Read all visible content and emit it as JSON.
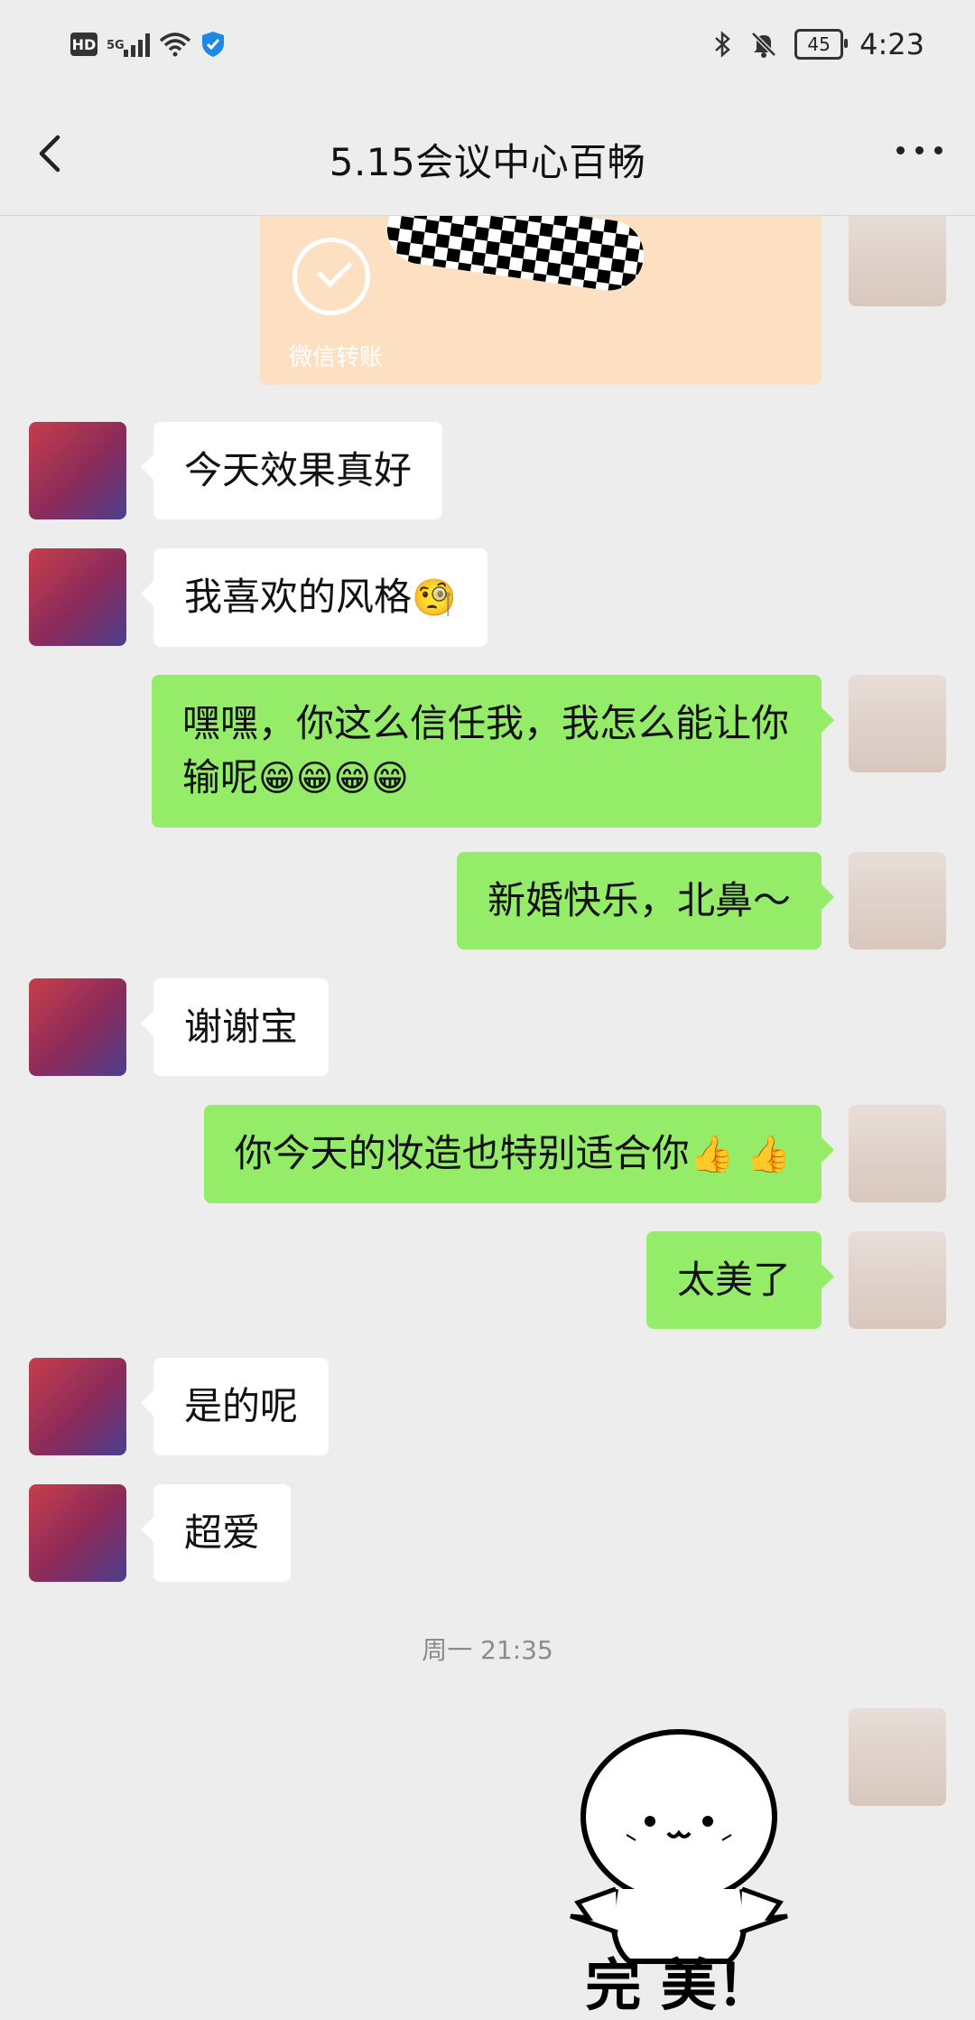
{
  "status_bar": {
    "hd": "HD",
    "network": "5G",
    "time": "4:23",
    "battery": "45"
  },
  "nav": {
    "title": "5.15会议中心百畅"
  },
  "transfer": {
    "label": "微信转账"
  },
  "messages": [
    {
      "from": "other",
      "text": "今天效果真好"
    },
    {
      "from": "other",
      "text": "我喜欢的风格",
      "emoji": "🧐"
    },
    {
      "from": "me",
      "text": "嘿嘿，你这么信任我，我怎么能让你输呢",
      "emoji": "😁😁😁😁"
    },
    {
      "from": "me",
      "text": "新婚快乐，北鼻～"
    },
    {
      "from": "other",
      "text": "谢谢宝"
    },
    {
      "from": "me",
      "text": "你今天的妆造也特别适合你",
      "emoji": "👍 👍"
    },
    {
      "from": "me",
      "text": "太美了"
    },
    {
      "from": "other",
      "text": "是的呢"
    },
    {
      "from": "other",
      "text": "超爱"
    }
  ],
  "timestamp": "周一 21:35",
  "sticker": {
    "text": "完 美！"
  },
  "colors": {
    "background": "#ededed",
    "my_bubble": "#95ec69",
    "other_bubble": "#ffffff",
    "transfer_card": "#fde0c2"
  }
}
